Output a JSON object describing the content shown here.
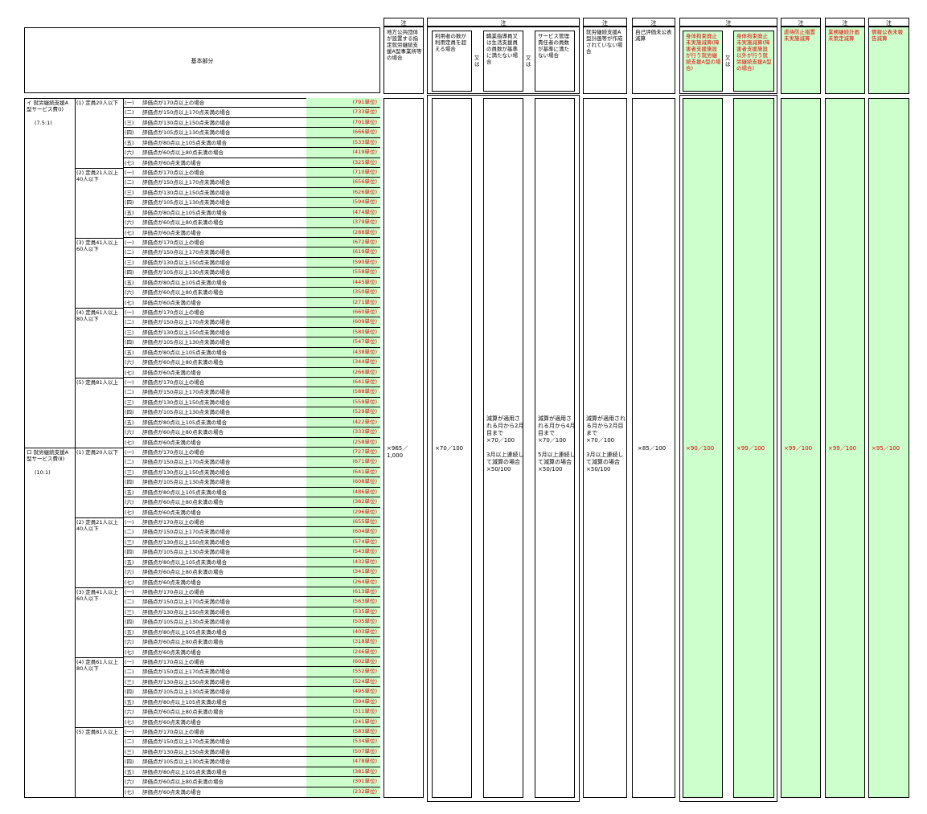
{
  "note": "注",
  "matata": "又\nは",
  "header": {
    "base": "基本部分",
    "col_public": "地方公共団体が設置する指定就労継続支援A型事業所等の場合",
    "col_capacity": "利用者の数が利用定員を超える場合",
    "col_staff": "職業指導員又は生活支援員の員数が基準に満たない場合",
    "col_manager": "サービス管理責任者の員数が基準に満たない場合",
    "col_plan": "就労継続支援A型計画等が作成されていない場合",
    "col_selfeval": "自己評価未公表減算",
    "col_restraint1": "身体拘束廃止未実施減算(障害者支援施設が行う就労継続支援A型の場合)",
    "col_restraint2": "身体拘束廃止未実施減算(障害者支援施設以外が行う就労継続支援A型の場合)",
    "col_abuse": "虐待防止措置未実施減算",
    "col_bcp": "業務継続計画未策定減算",
    "col_info": "情報公表未報告減算"
  },
  "values": {
    "public": "×965／1,000",
    "capacity": "×70／100",
    "staff": "減算が適用される月から2月目まで\n×70／100\n\n3月以上連続して減算の場合\n×50/100",
    "manager": "減算が適用される月から4月目まで\n×70／100\n\n5月以上連続して減算の場合\n×50/100",
    "plan": "減算が適用される月から2月目まで\n×70／100\n\n3月以上連続して減算の場合\n×50/100",
    "selfeval": "×85／100",
    "restraint1": "×90／100",
    "restraint2": "×99／100",
    "abuse": "×99／100",
    "bcp": "×99／100",
    "info": "×95／100"
  },
  "indices": [
    "(一)",
    "(二)",
    "(三)",
    "(四)",
    "(五)",
    "(六)",
    "(七)"
  ],
  "conditions": [
    "評価点が170点以上の場合",
    "評価点が150点以上170点未満の場合",
    "評価点が130点以上150点未満の場合",
    "評価点が105点以上130点未満の場合",
    "評価点が80点以上105点未満の場合",
    "評価点が60点以上80点未満の場合",
    "評価点が60点未満の場合"
  ],
  "services": [
    {
      "label": "イ 就労継続支援A型サービス費(Ⅰ)",
      "ratio": "(7.5:1)",
      "groups": [
        {
          "label": "(1) 定員20人以下",
          "units": [
            "(791単位)",
            "(733単位)",
            "(701単位)",
            "(666単位)",
            "(533単位)",
            "(419単位)",
            "(325単位)"
          ]
        },
        {
          "label": "(2) 定員21人以上40人以下",
          "units": [
            "(710単位)",
            "(656単位)",
            "(626単位)",
            "(594単位)",
            "(474単位)",
            "(379単位)",
            "(288単位)"
          ]
        },
        {
          "label": "(3) 定員41人以上60人以下",
          "units": [
            "(672単位)",
            "(619単位)",
            "(590単位)",
            "(558単位)",
            "(445単位)",
            "(350単位)",
            "(271単位)"
          ]
        },
        {
          "label": "(4) 定員61人以上80人以下",
          "units": [
            "(660単位)",
            "(609単位)",
            "(580単位)",
            "(547単位)",
            "(438単位)",
            "(344単位)",
            "(266単位)"
          ]
        },
        {
          "label": "(5) 定員81人以上",
          "units": [
            "(641単位)",
            "(588単位)",
            "(559単位)",
            "(529単位)",
            "(422単位)",
            "(333単位)",
            "(258単位)"
          ]
        }
      ]
    },
    {
      "label": "ロ 就労継続支援A型サービス費(Ⅱ)",
      "ratio": "(10:1)",
      "groups": [
        {
          "label": "(1) 定員20人以下",
          "units": [
            "(727単位)",
            "(671単位)",
            "(641単位)",
            "(608単位)",
            "(486単位)",
            "(382単位)",
            "(296単位)"
          ]
        },
        {
          "label": "(2) 定員21人以上40人以下",
          "units": [
            "(655単位)",
            "(604単位)",
            "(574単位)",
            "(543単位)",
            "(432単位)",
            "(341単位)",
            "(264単位)"
          ]
        },
        {
          "label": "(3) 定員41人以上60人以下",
          "units": [
            "(613単位)",
            "(563単位)",
            "(535単位)",
            "(505単位)",
            "(403単位)",
            "(318単位)",
            "(246単位)"
          ]
        },
        {
          "label": "(4) 定員61人以上80人以下",
          "units": [
            "(602単位)",
            "(552単位)",
            "(524単位)",
            "(495単位)",
            "(394単位)",
            "(311単位)",
            "(241単位)"
          ]
        },
        {
          "label": "(5) 定員81人以上",
          "units": [
            "(583単位)",
            "(534単位)",
            "(507単位)",
            "(478単位)",
            "(381単位)",
            "(301単位)",
            "(232単位)"
          ]
        }
      ]
    }
  ]
}
